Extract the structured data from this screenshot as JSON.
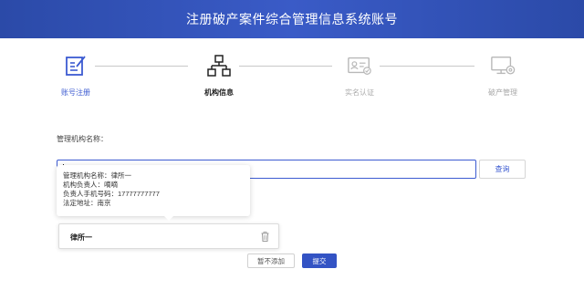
{
  "header": {
    "title": "注册破产案件综合管理信息系统账号"
  },
  "steps": [
    {
      "label": "账号注册",
      "icon": "edit-form-icon",
      "state": "done"
    },
    {
      "label": "机构信息",
      "icon": "org-structure-icon",
      "state": "active"
    },
    {
      "label": "实名认证",
      "icon": "id-card-icon",
      "state": "pending"
    },
    {
      "label": "破产管理",
      "icon": "monitor-gear-icon",
      "state": "pending"
    }
  ],
  "form": {
    "org_name_label": "管理机构名称：",
    "search_value": "",
    "search_button": "查询"
  },
  "tooltip": {
    "lines": [
      "管理机构名称：律所一",
      "机构负责人：嘀嘀",
      "负责人手机号码：17777777777",
      "法定地址：南京"
    ]
  },
  "result": {
    "name": "律所一"
  },
  "actions": {
    "skip_label": "暂不添加",
    "submit_label": "提交"
  },
  "colors": {
    "accent": "#3c5bd1",
    "header": "#2b4aa8"
  }
}
